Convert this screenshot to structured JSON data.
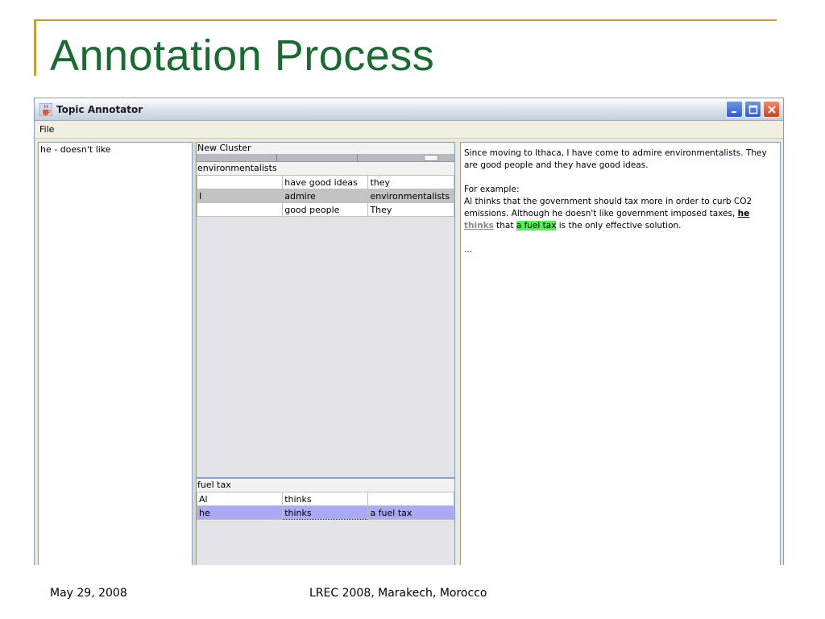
{
  "slide": {
    "title": "Annotation Process",
    "footer_date": "May 29, 2008",
    "footer_event": "LREC 2008, Marakech, Morocco"
  },
  "colors": {
    "title_green": "#1a6b30",
    "rule_gold": "#c8a032",
    "selected_row": "#a9a9f4",
    "highlight_green": "#55f055"
  },
  "window": {
    "title": "Topic Annotator",
    "icon": "java-cup-icon",
    "controls": [
      "minimize-icon",
      "maximize-icon",
      "close-icon"
    ]
  },
  "menu": {
    "file": "File"
  },
  "left_list": {
    "items": [
      "he - doesn't like"
    ]
  },
  "middle": {
    "new_cluster": "New Cluster",
    "group1": {
      "label": "environmentalists",
      "rows": [
        [
          "",
          "have good ideas",
          "they"
        ],
        [
          "I",
          "admire",
          "environmentalists"
        ],
        [
          "",
          "good people",
          "They"
        ]
      ]
    },
    "group2": {
      "label": "fuel tax",
      "rows": [
        [
          "Al",
          "thinks",
          ""
        ],
        [
          "he",
          "thinks",
          "a fuel tax"
        ]
      ]
    }
  },
  "document": {
    "p1": "Since moving to Ithaca, I have come to admire environmentalists. They are good people and they have good ideas.",
    "p2_line1": "For example:",
    "p2_line2a": "Al thinks that the government should tax more in order to curb CO2 emissions. Although he doesn't like government imposed taxes, ",
    "p2_he": "he",
    "p2_space": " ",
    "p2_thinks": "thinks",
    "p2_that": " that ",
    "p2_fueltax": "a fuel tax",
    "p2_rest": " is the only effective solution.",
    "ellipsis": "..."
  }
}
